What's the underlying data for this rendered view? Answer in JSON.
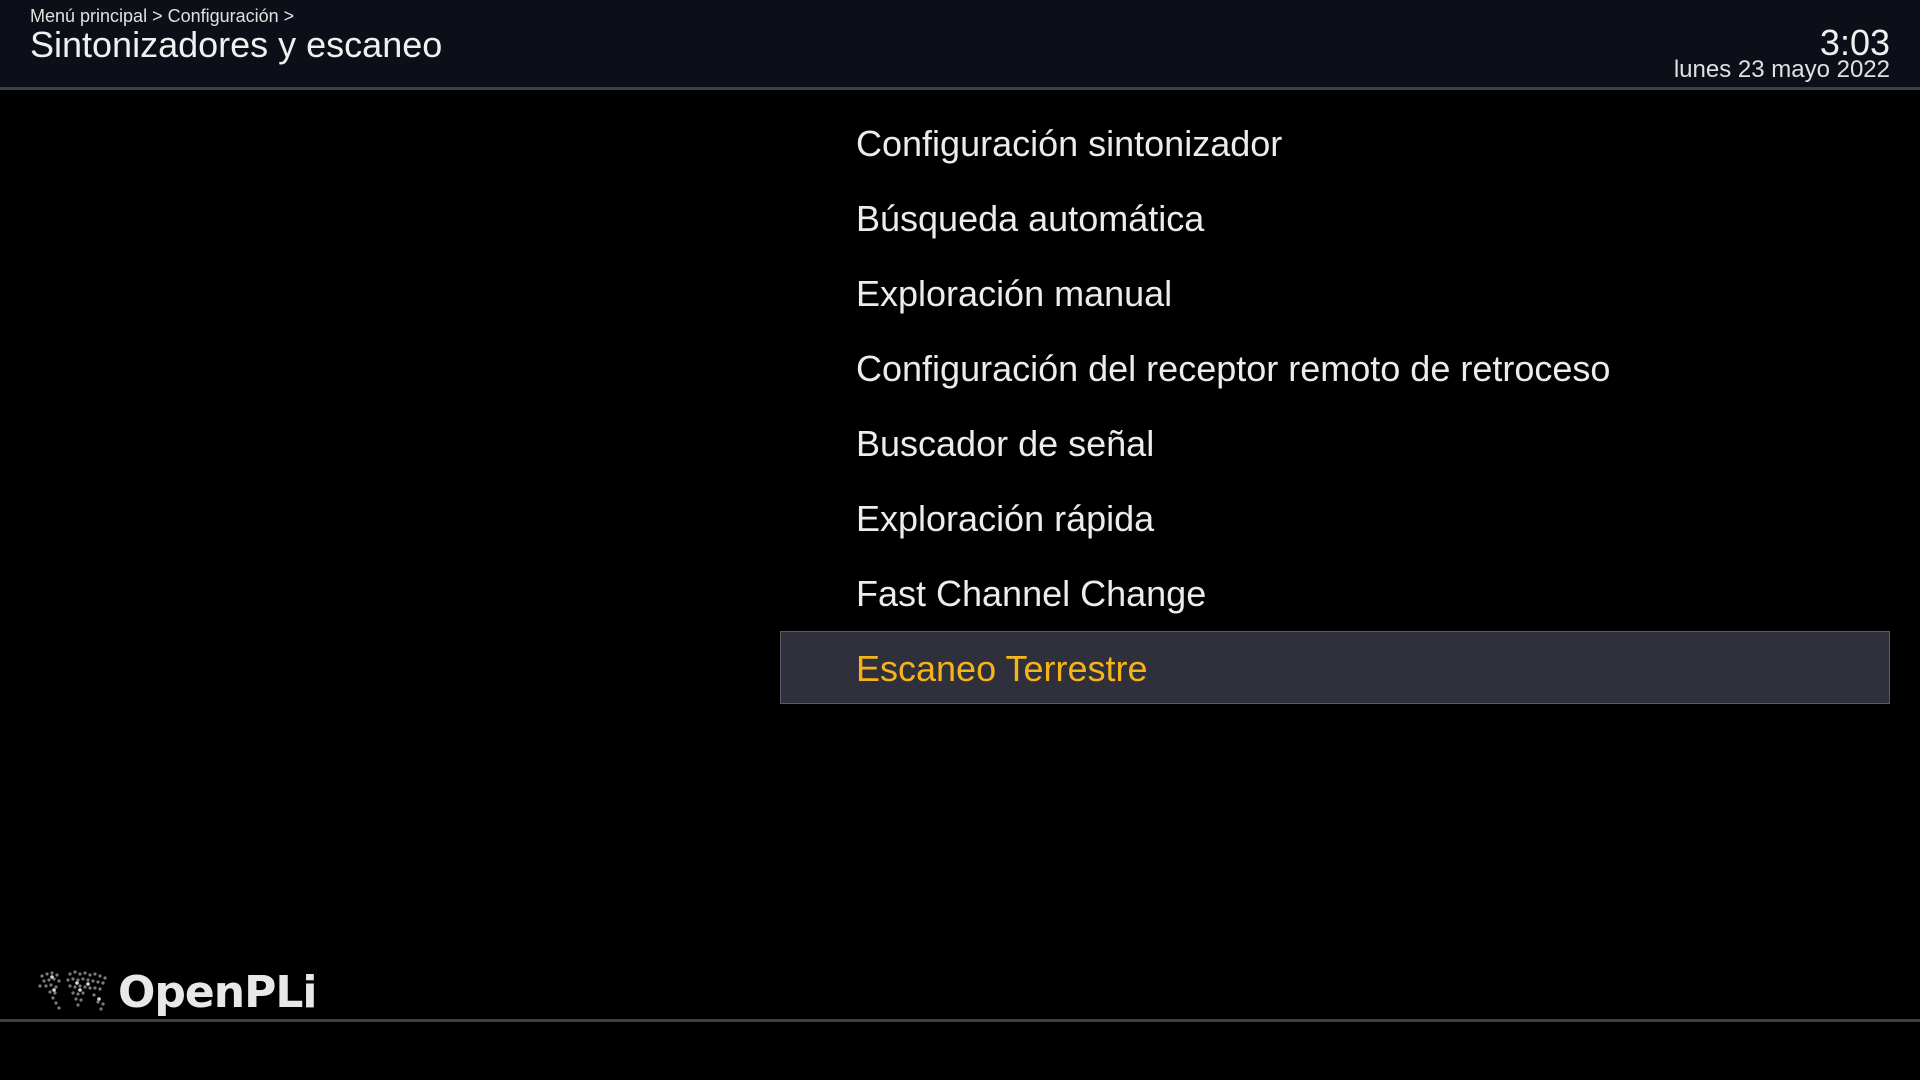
{
  "header": {
    "breadcrumb": "Menú principal > Configuración >",
    "title": "Sintonizadores y escaneo",
    "time": "3:03",
    "date": "lunes 23 mayo 2022"
  },
  "menu": {
    "items": [
      {
        "label": "Configuración sintonizador"
      },
      {
        "label": "Búsqueda automática"
      },
      {
        "label": "Exploración manual"
      },
      {
        "label": "Configuración del receptor remoto de retroceso"
      },
      {
        "label": "Buscador de señal"
      },
      {
        "label": "Exploración rápida"
      },
      {
        "label": "Fast Channel Change"
      },
      {
        "label": "Escaneo Terrestre"
      }
    ],
    "selected_index": 7
  },
  "footer": {
    "logo_text": "OpenPLi",
    "logo_icon": "world-map-dots-icon"
  },
  "colors": {
    "header_bg": "#0c0f17",
    "selection_bg": "#2f303c",
    "selected_text": "#f4b41a",
    "text": "#ececec"
  }
}
